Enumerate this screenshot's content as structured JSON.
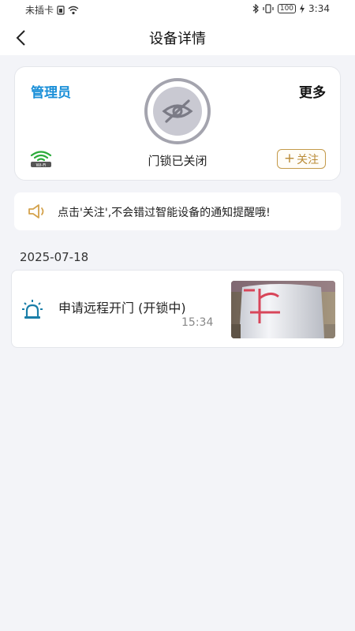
{
  "status_bar": {
    "carrier": "未插卡",
    "battery": "100",
    "time": "3:34"
  },
  "header": {
    "title": "设备详情"
  },
  "device": {
    "role": "管理员",
    "more": "更多",
    "wifi_label": "Wi-Fi",
    "lock_status": "门锁已关闭",
    "follow_label": "关注",
    "follow_plus": "+"
  },
  "notice": {
    "text": "点击'关注',不会错过智能设备的通知提醒哦!"
  },
  "events": {
    "date": "2025-07-18",
    "items": [
      {
        "title": "申请远程开门 (开锁中)",
        "time": "15:34"
      }
    ]
  },
  "colors": {
    "accent": "#1a8fd8",
    "follow": "#c49a4a",
    "background": "#f3f4f8"
  }
}
